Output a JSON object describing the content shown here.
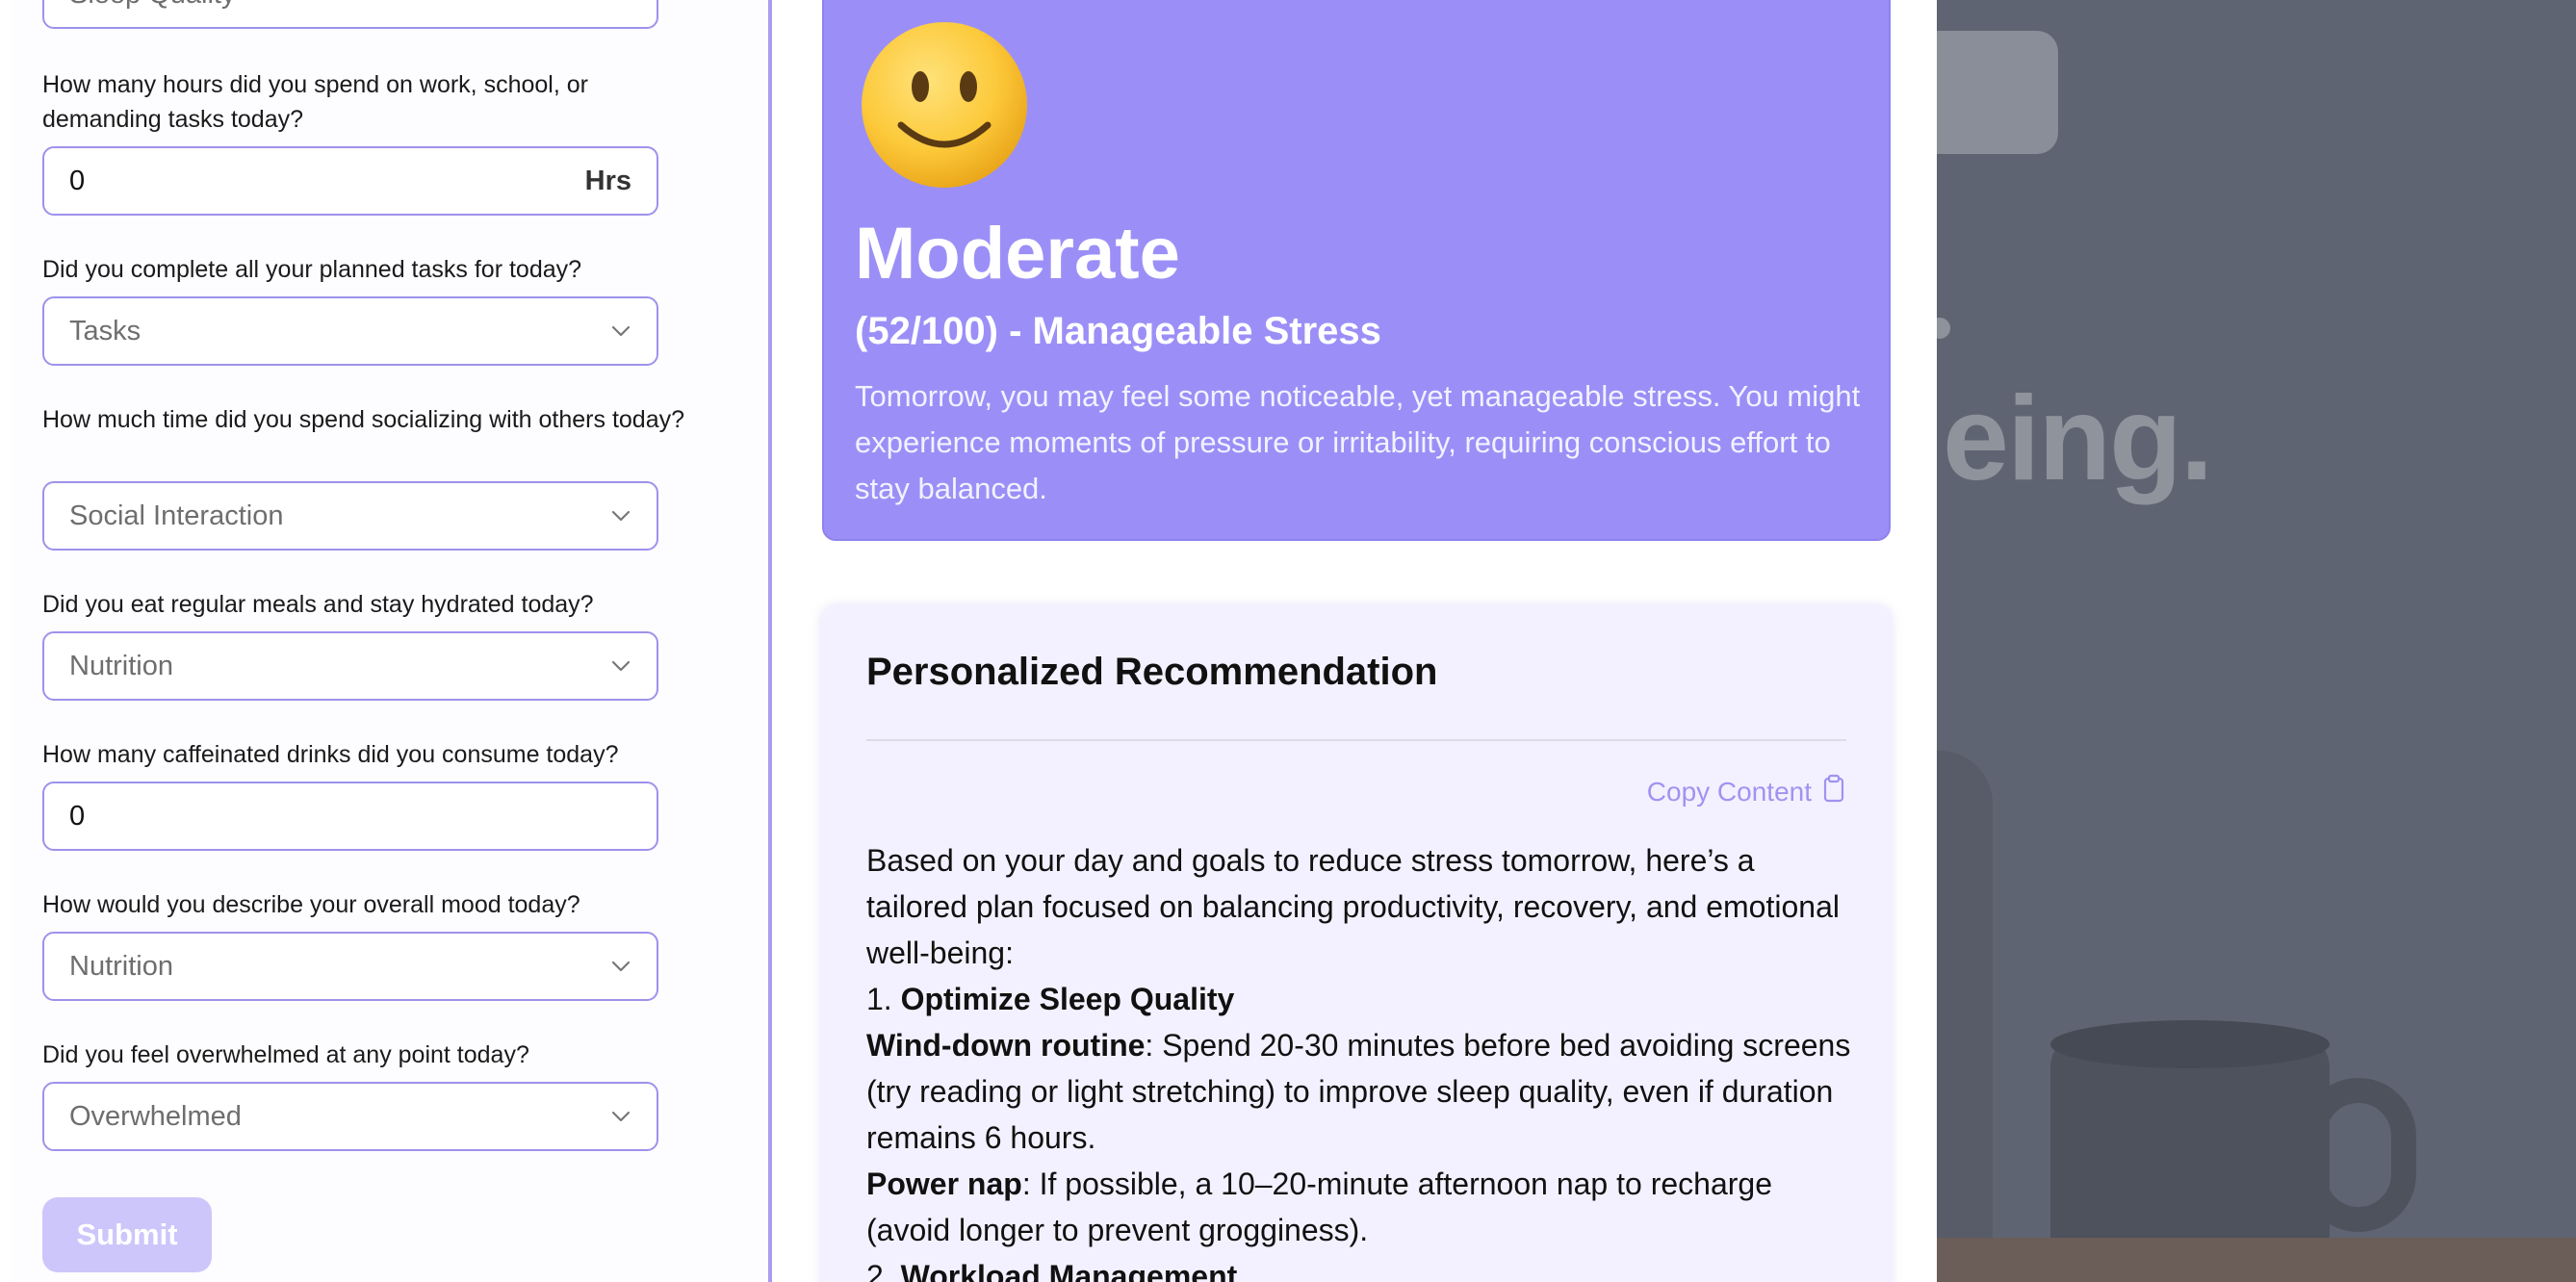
{
  "background": {
    "heading_fragment": "eing."
  },
  "form": {
    "top_select": {
      "label": "Sleep Quality",
      "icon": "chevron-down-icon"
    },
    "work_hours": {
      "question": "How many hours did you spend on work, school, or demanding tasks today?",
      "value": "0",
      "suffix": "Hrs"
    },
    "tasks": {
      "question": "Did you complete all your planned tasks for today?",
      "label": "Tasks"
    },
    "social": {
      "question": "How much time did you spend socializing with others today?",
      "label": "Social Interaction"
    },
    "nutrition": {
      "question": "Did you eat regular meals and stay hydrated today?",
      "label": "Nutrition"
    },
    "caffeine": {
      "question": "How many caffeinated drinks did you consume today?",
      "value": "0"
    },
    "mood": {
      "question": "How would you describe your overall mood today?",
      "label": "Nutrition"
    },
    "overwhelmed": {
      "question": "Did you feel overwhelmed at any point today?",
      "label": "Overwhelmed"
    },
    "submit_label": "Submit"
  },
  "result": {
    "emoji_icon": "slightly-smiling-face-icon",
    "level": "Moderate",
    "score_text": "(52/100) - Manageable Stress",
    "score": 52,
    "description": "Tomorrow, you may feel some noticeable, yet manageable stress. You might experience moments of pressure or irritability, requiring conscious effort to stay balanced."
  },
  "recommendation": {
    "title": "Personalized Recommendation",
    "copy_label": "Copy Content",
    "intro": "Based on your day and goals to reduce stress tomorrow, here’s a tailored plan focused on balancing productivity, recovery, and emotional well-being:",
    "item1_number": "1. ",
    "item1_title": "Optimize Sleep Quality",
    "winddown_title": "Wind-down routine",
    "winddown_text": ": Spend 20-30 minutes before bed avoiding screens (try reading or light stretching) to improve sleep quality, even if duration remains 6 hours.",
    "powernap_title": "Power nap",
    "powernap_text": ": If possible, a 10–20-minute afternoon nap to recharge (avoid longer to prevent grogginess).",
    "item2_number": "2. ",
    "item2_title": "Workload Management"
  },
  "colors": {
    "accent": "#9b8ff7",
    "field_border": "#9d92ec",
    "submit_disabled": "#cdc6fb",
    "rec_bg": "#f3f1ff"
  }
}
